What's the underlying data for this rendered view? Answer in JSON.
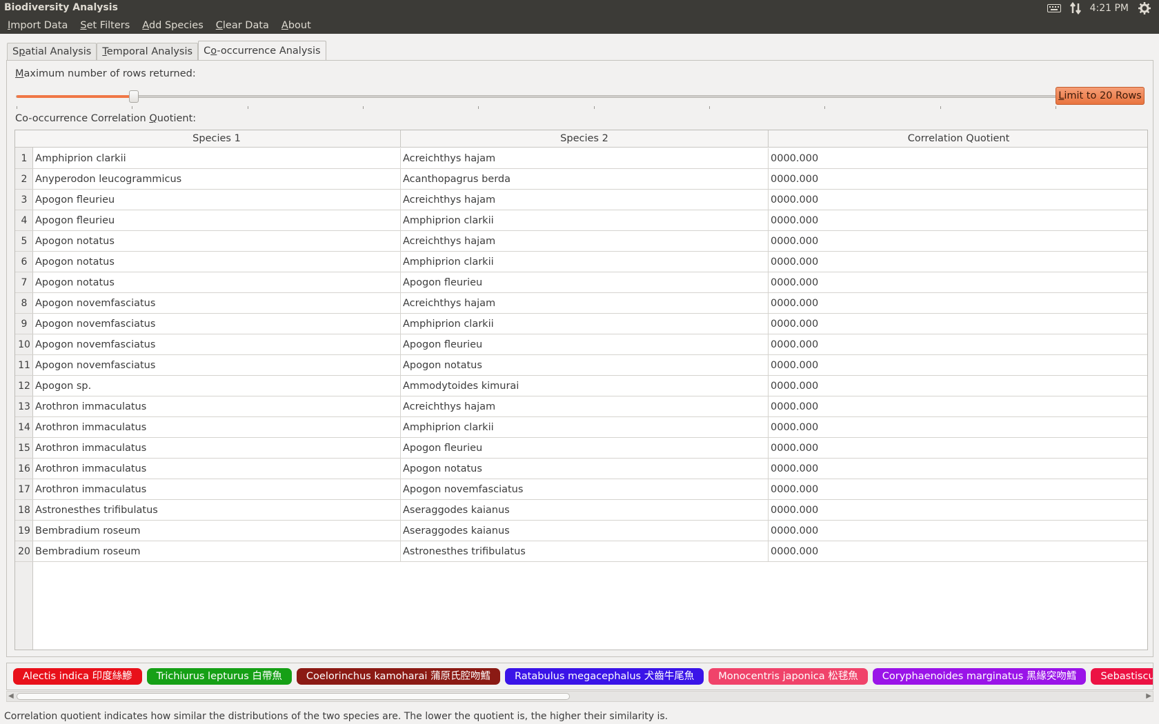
{
  "window": {
    "title": "Biodiversity Analysis"
  },
  "tray": {
    "keyboard_icon": "keyboard-icon",
    "network_icon": "network-arrows-icon",
    "clock": "4:21 PM",
    "settings_icon": "gear-icon"
  },
  "menu": {
    "items": [
      {
        "key": "I",
        "rest": "mport Data"
      },
      {
        "key": "S",
        "rest": "et Filters"
      },
      {
        "key": "A",
        "rest": "dd Species"
      },
      {
        "key": "C",
        "rest": "lear Data"
      },
      {
        "key": "A",
        "rest": "bout"
      }
    ]
  },
  "tabs": [
    {
      "pre": "S",
      "key": "p",
      "post": "atial Analysis",
      "active": false
    },
    {
      "pre": "",
      "key": "T",
      "post": "emporal Analysis",
      "active": false
    },
    {
      "pre": "C",
      "key": "o",
      "post": "-occurrence Analysis",
      "active": true
    }
  ],
  "controls": {
    "rows_label_key": "M",
    "rows_label_rest": "aximum number of rows returned:",
    "slider_fraction": 0.113,
    "limit_button_key": "L",
    "limit_button_rest": "imit to 20 Rows",
    "cq_label_pre": "Co-occurrence Correlation ",
    "cq_label_key": "Q",
    "cq_label_post": "uotient:"
  },
  "table": {
    "headers": [
      "Species 1",
      "Species 2",
      "Correlation Quotient"
    ],
    "rows": [
      [
        "1",
        "Amphiprion clarkii",
        "Acreichthys hajam",
        "0000.000"
      ],
      [
        "2",
        "Anyperodon leucogrammicus",
        "Acanthopagrus berda",
        "0000.000"
      ],
      [
        "3",
        "Apogon fleurieu",
        "Acreichthys hajam",
        "0000.000"
      ],
      [
        "4",
        "Apogon fleurieu",
        "Amphiprion clarkii",
        "0000.000"
      ],
      [
        "5",
        "Apogon notatus",
        "Acreichthys hajam",
        "0000.000"
      ],
      [
        "6",
        "Apogon notatus",
        "Amphiprion clarkii",
        "0000.000"
      ],
      [
        "7",
        "Apogon notatus",
        "Apogon fleurieu",
        "0000.000"
      ],
      [
        "8",
        "Apogon novemfasciatus",
        "Acreichthys hajam",
        "0000.000"
      ],
      [
        "9",
        "Apogon novemfasciatus",
        "Amphiprion clarkii",
        "0000.000"
      ],
      [
        "10",
        "Apogon novemfasciatus",
        "Apogon fleurieu",
        "0000.000"
      ],
      [
        "11",
        "Apogon novemfasciatus",
        "Apogon notatus",
        "0000.000"
      ],
      [
        "12",
        "Apogon sp.",
        "Ammodytoides kimurai",
        "0000.000"
      ],
      [
        "13",
        "Arothron immaculatus",
        "Acreichthys hajam",
        "0000.000"
      ],
      [
        "14",
        "Arothron immaculatus",
        "Amphiprion clarkii",
        "0000.000"
      ],
      [
        "15",
        "Arothron immaculatus",
        "Apogon fleurieu",
        "0000.000"
      ],
      [
        "16",
        "Arothron immaculatus",
        "Apogon notatus",
        "0000.000"
      ],
      [
        "17",
        "Arothron immaculatus",
        "Apogon novemfasciatus",
        "0000.000"
      ],
      [
        "18",
        "Astronesthes trifibulatus",
        "Aseraggodes kaianus",
        "0000.000"
      ],
      [
        "19",
        "Bembradium roseum",
        "Aseraggodes kaianus",
        "0000.000"
      ],
      [
        "20",
        "Bembradium roseum",
        "Astronesthes trifibulatus",
        "0000.000"
      ]
    ]
  },
  "species_chips": [
    {
      "label": "Alectis indica 印度絲鰺",
      "color": "#e8101a"
    },
    {
      "label": "Trichiurus lepturus 白帶魚",
      "color": "#16a016"
    },
    {
      "label": "Coelorinchus kamoharai 蒲原氏腔吻鱈",
      "color": "#8b1a14"
    },
    {
      "label": "Ratabulus megacephalus 犬齒牛尾魚",
      "color": "#3a14e8"
    },
    {
      "label": "Monocentris japonica 松毬魚",
      "color": "#f0436a"
    },
    {
      "label": "Coryphaenoides marginatus 黑緣突吻鱈",
      "color": "#9a14e8"
    },
    {
      "label": "Sebastiscus marmoratus",
      "color": "#ec1243"
    }
  ],
  "status": {
    "text": "Correlation quotient indicates how similar the distributions of the two species are. The lower the quotient is, the higher their similarity is."
  }
}
